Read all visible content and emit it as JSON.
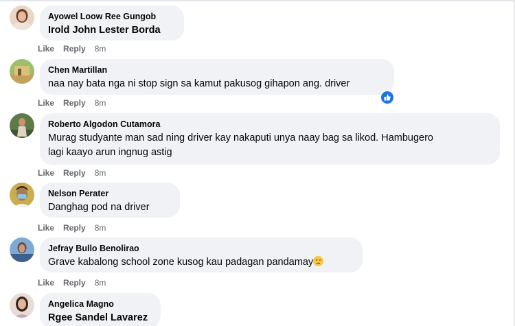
{
  "comments": [
    {
      "author": "Ayowel Loow Ree Gungob",
      "text": "Irold John Lester Borda",
      "text_tagged": true,
      "like": "Like",
      "reply": "Reply",
      "time": "8m"
    },
    {
      "author": "Chen Martillan",
      "text": "naa nay bata nga ni stop sign sa kamut pakusog gihapon ang. driver",
      "like": "Like",
      "reply": "Reply",
      "time": "8m",
      "reaction": "like-reaction-icon"
    },
    {
      "author": "Roberto Algodon Cutamora",
      "text_line1": "Murag studyante man sad ning driver kay nakaputi unya naay bag sa likod. Hambugero",
      "text_line2": "lagi kaayo arun ingnug astig",
      "like": "Like",
      "reply": "Reply",
      "time": "8m"
    },
    {
      "author": "Nelson Perater",
      "text": "Danghag pod na driver",
      "like": "Like",
      "reply": "Reply",
      "time": "8m"
    },
    {
      "author": "Jefray Bullo Benolirao",
      "text": "Grave kabalong school zone kusog kau padagan pandamay",
      "emoji": "sad-face-emoji",
      "like": "Like",
      "reply": "Reply",
      "time": "8m"
    },
    {
      "author": "Angelica Magno",
      "text": "Rgee Sandel Lavarez",
      "text_tagged": true
    }
  ],
  "colors": {
    "bubble": "#f0f2f5",
    "text": "#050505",
    "meta": "#65676b",
    "like_blue": "#1b74e4",
    "emoji_yellow": "#f7c84a"
  }
}
